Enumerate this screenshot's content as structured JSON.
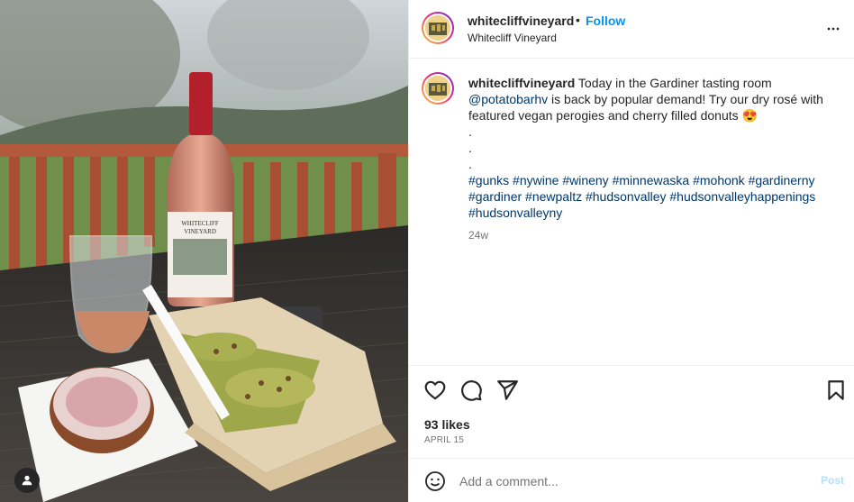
{
  "post": {
    "username": "whitecliffvineyard",
    "separator": "•",
    "follow_label": "Follow",
    "subtitle": "Whitecliff Vineyard",
    "more_icon": "more-horizontal-icon"
  },
  "caption": {
    "username": "whitecliffvineyard",
    "text_part1": " Today in the Gardiner tasting room ",
    "mention": "@potatobarhv",
    "text_part2": " is back by popular demand! Try our dry rosé with featured vegan perogies and cherry filled donuts ",
    "emoji": "😍",
    "dots": [
      ".",
      ".",
      "."
    ],
    "hashtags": [
      "#gunks",
      "#nywine",
      "#wineny",
      "#minnewaska",
      "#mohonk",
      "#gardinerny",
      "#gardiner",
      "#newpaltz",
      "#hudsonvalley",
      "#hudsonvalleyhappenings",
      "#hudsonvalleyny"
    ],
    "time": "24w"
  },
  "media": {
    "bottle_label_line1": "WHITECLIFF",
    "bottle_label_line2": "VINEYARD",
    "user_tag_icon": "user-tag-icon"
  },
  "actions": {
    "icons": [
      "heart-icon",
      "comment-icon",
      "share-icon",
      "bookmark-icon"
    ],
    "likes": "93 likes",
    "date": "APRIL 15"
  },
  "comment": {
    "placeholder": "Add a comment...",
    "post_label": "Post",
    "emoji_icon": "emoji-icon"
  },
  "colors": {
    "accent": "#0095f6",
    "link": "#00376b",
    "muted": "#737373",
    "post_disabled": "#b2dffc"
  }
}
